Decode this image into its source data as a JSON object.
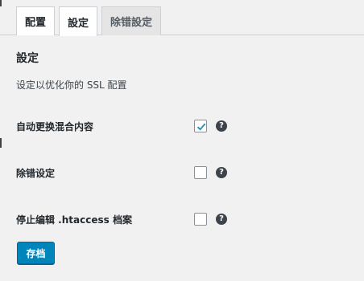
{
  "tabs": [
    {
      "label": "配置"
    },
    {
      "label": "設定"
    },
    {
      "label": "除错設定"
    }
  ],
  "section": {
    "title": "設定",
    "description": "设定以优化你的 SSL 配置"
  },
  "settings": [
    {
      "label": "自动更换混合内容",
      "checked": true,
      "help_icon": "question-circle-icon"
    },
    {
      "label": "除错设定",
      "checked": false,
      "help_icon": "question-circle-icon"
    },
    {
      "label": "停止编辑 .htaccess 档案",
      "checked": false,
      "help_icon": "question-circle-icon"
    }
  ],
  "help_glyph": "?",
  "save_label": "存档",
  "colors": {
    "accent": "#0085ba",
    "check": "#1e8cbe",
    "background": "#f1f1f1"
  }
}
